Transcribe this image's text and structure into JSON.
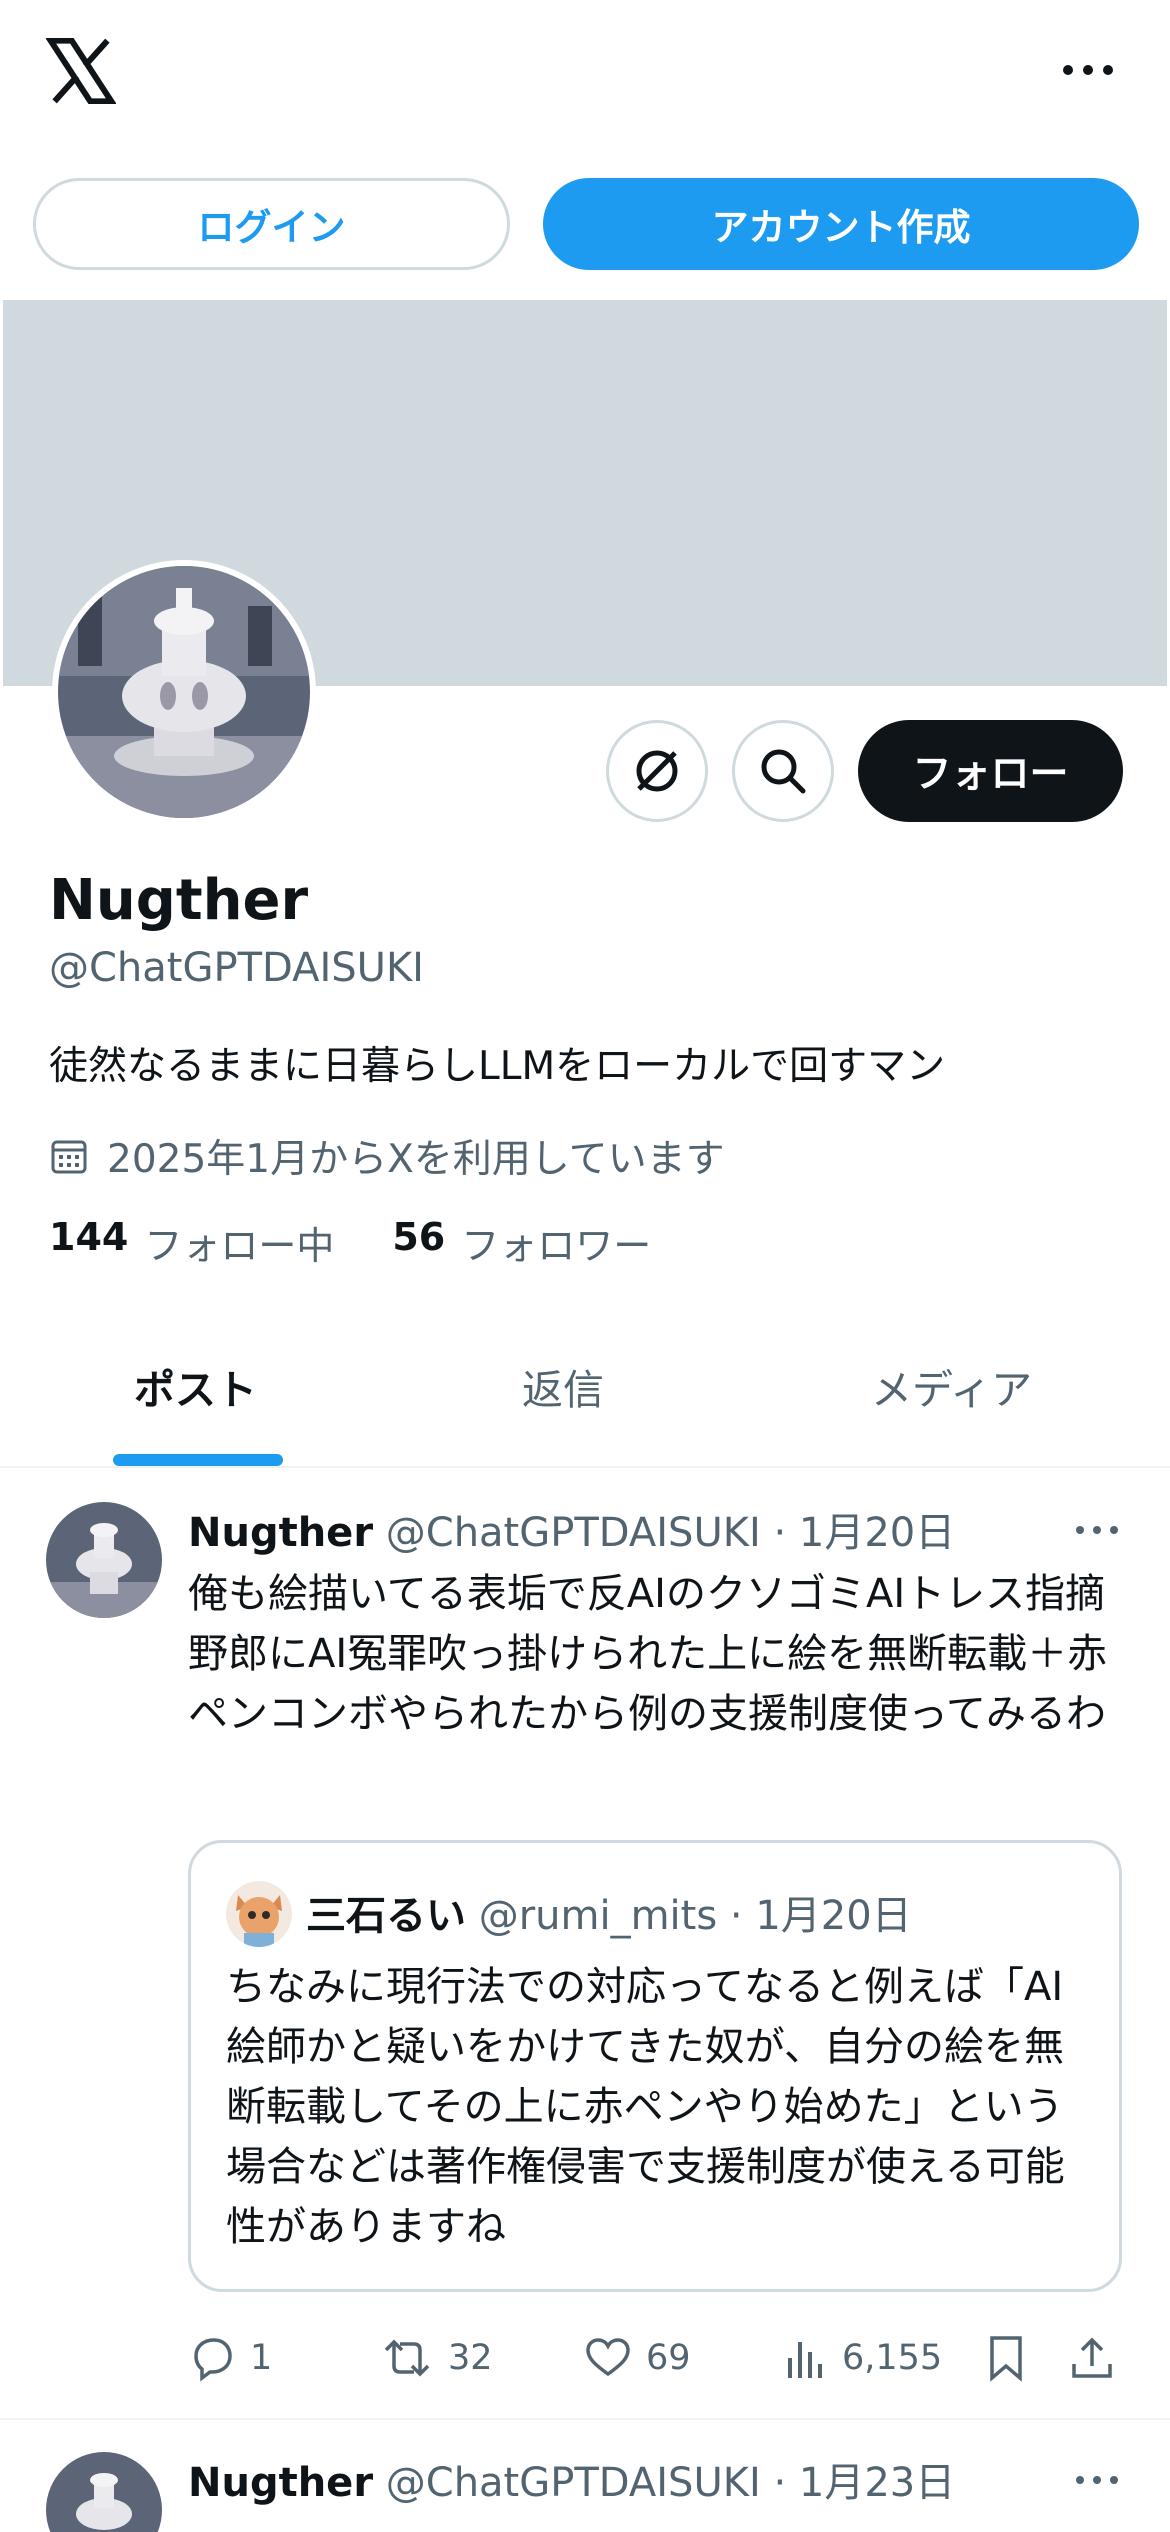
{
  "header": {
    "logo": "x-logo",
    "more_icon": "ellipsis-icon",
    "login_label": "ログイン",
    "signup_label": "アカウント作成"
  },
  "profile": {
    "display_name": "Nugther",
    "handle": "@ChatGPTDAISUKI",
    "bio": "徒然なるままに日暮らしLLMをローカルで回すマン",
    "joined": "2025年1月からXを利用しています",
    "following_count": "144",
    "following_label": "フォロー中",
    "followers_count": "56",
    "followers_label": "フォロワー",
    "follow_label": "フォロー",
    "banner_color": "#cfd9de"
  },
  "tabs": [
    {
      "label": "ポスト",
      "active": true
    },
    {
      "label": "返信",
      "active": false
    },
    {
      "label": "メディア",
      "active": false
    }
  ],
  "posts": [
    {
      "name": "Nugther",
      "handle": "@ChatGPTDAISUKI",
      "date": "· 1月20日",
      "text": "俺も絵描いてる表垢で反AIのクソゴミAIトレス指摘野郎にAI冤罪吹っ掛けられた上に絵を無断転載＋赤ペンコンボやられたから例の支援制度使ってみるわ",
      "quote": {
        "name": "三石るい",
        "handle": "@rumi_mits",
        "date": "· 1月20日",
        "text": "ちなみに現行法での対応ってなると例えば「AI絵師かと疑いをかけてきた奴が、自分の絵を無断転載してその上に赤ペンやり始めた」という場合などは著作権侵害で支援制度が使える可能性がありますね"
      },
      "stats": {
        "replies": "1",
        "reposts": "32",
        "likes": "69",
        "views": "6,155"
      }
    },
    {
      "name": "Nugther",
      "handle": "@ChatGPTDAISUKI",
      "date": "· 1月23日"
    }
  ],
  "colors": {
    "accent": "#1d9bf0",
    "text": "#0f1419",
    "muted": "#536471",
    "border": "#cfd9de"
  }
}
